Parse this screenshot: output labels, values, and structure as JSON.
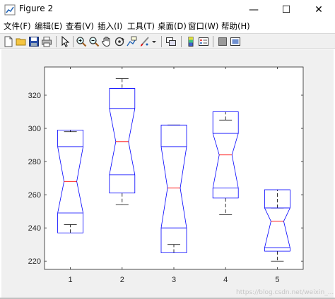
{
  "window": {
    "title": "Figure 2",
    "controls": [
      "—",
      "☐",
      "✕"
    ]
  },
  "menu": [
    {
      "label": "文件(F)"
    },
    {
      "label": "编辑(E)"
    },
    {
      "label": "查看(V)"
    },
    {
      "label": "插入(I)"
    },
    {
      "label": "工具(T)"
    },
    {
      "label": "桌面(D)"
    },
    {
      "label": "窗口(W)"
    },
    {
      "label": "帮助(H)"
    }
  ],
  "toolbar": {
    "icons": [
      "new-figure-icon",
      "open-file-icon",
      "save-icon",
      "print-icon",
      "select-arrow-icon",
      "zoom-in-icon",
      "zoom-out-icon",
      "pan-icon",
      "rotate-3d-icon",
      "data-cursor-icon",
      "brush-icon",
      "brush-dropdown-icon",
      "link-plot-icon",
      "colorbar-icon",
      "legend-icon",
      "hide-plot-tools-icon",
      "show-plot-tools-icon"
    ]
  },
  "colors": {
    "box": "#0000ff",
    "median": "#ff0000",
    "whisker": "#000000",
    "figure_bg": "#f0f0f0",
    "axes_bg": "#ffffff"
  },
  "watermark": "https://blog.csdn.net/weixin_...",
  "chart_data": {
    "type": "boxplot",
    "notched": true,
    "categories": [
      "1",
      "2",
      "3",
      "4",
      "5"
    ],
    "ylim": [
      215,
      337
    ],
    "yticks": [
      220,
      240,
      260,
      280,
      300,
      320
    ],
    "ytick_labels": [
      "220",
      "240",
      "260",
      "280",
      "300",
      "320"
    ],
    "grid": false,
    "boxes": [
      {
        "label": "1",
        "lower_whisker": 242,
        "q1": 249,
        "notch_low": 249,
        "median": 268,
        "notch_high": 289,
        "q3": 289,
        "upper_whisker": 298,
        "box_top": 299,
        "box_bottom": 237
      },
      {
        "label": "2",
        "lower_whisker": 254,
        "q1": 272,
        "notch_low": 272,
        "median": 292,
        "notch_high": 312,
        "q3": 312,
        "upper_whisker": 330,
        "box_top": 324,
        "box_bottom": 261
      },
      {
        "label": "3",
        "lower_whisker": 230,
        "q1": 240,
        "notch_low": 240,
        "median": 264,
        "notch_high": 289,
        "q3": 289,
        "upper_whisker": 302,
        "box_top": 302,
        "box_bottom": 225
      },
      {
        "label": "4",
        "lower_whisker": 248,
        "q1": 264,
        "notch_low": 264,
        "median": 284,
        "notch_high": 297,
        "q3": 297,
        "upper_whisker": 305,
        "box_top": 310,
        "box_bottom": 258
      },
      {
        "label": "5",
        "lower_whisker": 220,
        "q1": 228,
        "notch_low": 228,
        "median": 244,
        "notch_high": 252,
        "q3": 252,
        "upper_whisker": 252,
        "box_top": 263,
        "box_bottom": 226
      }
    ]
  }
}
